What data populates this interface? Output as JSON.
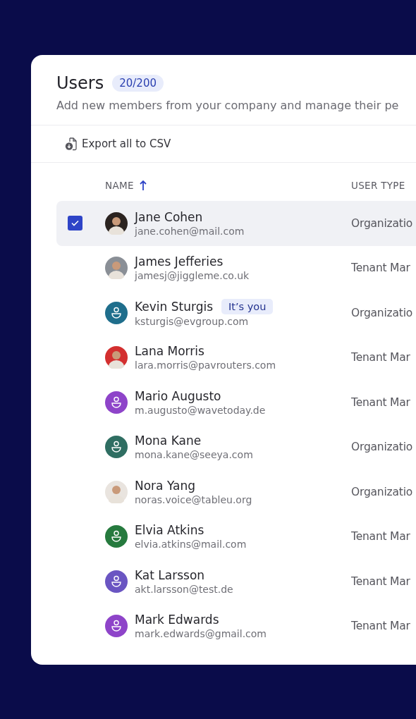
{
  "header": {
    "title": "Users",
    "count": "20/200",
    "subtitle": "Add new members from your company and manage their pe"
  },
  "toolbar": {
    "export_label": "Export all to CSV"
  },
  "table": {
    "columns": [
      {
        "label": "NAME",
        "sorted": true
      },
      {
        "label": "USER TYPE",
        "sorted": false
      }
    ],
    "rows": [
      {
        "name": "Jane Cohen",
        "email": "jane.cohen@mail.com",
        "user_type": "Organizatio",
        "selected": true,
        "avatar": {
          "kind": "photo",
          "color": "#2b2320"
        }
      },
      {
        "name": "James Jefferies",
        "email": "jamesj@jiggleme.co.uk",
        "user_type": "Tenant Mar",
        "selected": false,
        "avatar": {
          "kind": "photo",
          "color": "#8a8f96"
        }
      },
      {
        "name": "Kevin Sturgis",
        "badge": "It’s you",
        "email": "ksturgis@evgroup.com",
        "user_type": "Organizatio",
        "selected": false,
        "avatar": {
          "kind": "default",
          "color": "#1f6e8c"
        }
      },
      {
        "name": "Lana Morris",
        "email": "lara.morris@pavrouters.com",
        "user_type": "Tenant Mar",
        "selected": false,
        "avatar": {
          "kind": "photo",
          "color": "#d32f2f"
        }
      },
      {
        "name": "Mario Augusto",
        "email": "m.augusto@wavetoday.de",
        "user_type": "Tenant Mar",
        "selected": false,
        "avatar": {
          "kind": "default",
          "color": "#8e44c9"
        }
      },
      {
        "name": "Mona Kane",
        "email": "mona.kane@seeya.com",
        "user_type": "Organizatio",
        "selected": false,
        "avatar": {
          "kind": "default",
          "color": "#2f6e62"
        }
      },
      {
        "name": "Nora Yang",
        "email": "noras.voice@tableu.org",
        "user_type": "Organizatio",
        "selected": false,
        "avatar": {
          "kind": "photo",
          "color": "#e9e4df"
        }
      },
      {
        "name": "Elvia Atkins",
        "email": "elvia.atkins@mail.com",
        "user_type": "Tenant Mar",
        "selected": false,
        "avatar": {
          "kind": "default",
          "color": "#267a3e"
        }
      },
      {
        "name": "Kat Larsson",
        "email": "akt.larsson@test.de",
        "user_type": "Tenant Mar",
        "selected": false,
        "avatar": {
          "kind": "default",
          "color": "#6a55c2"
        }
      },
      {
        "name": "Mark Edwards",
        "email": "mark.edwards@gmail.com",
        "user_type": "Tenant Mar",
        "selected": false,
        "avatar": {
          "kind": "default",
          "color": "#8e44c9"
        }
      }
    ]
  }
}
